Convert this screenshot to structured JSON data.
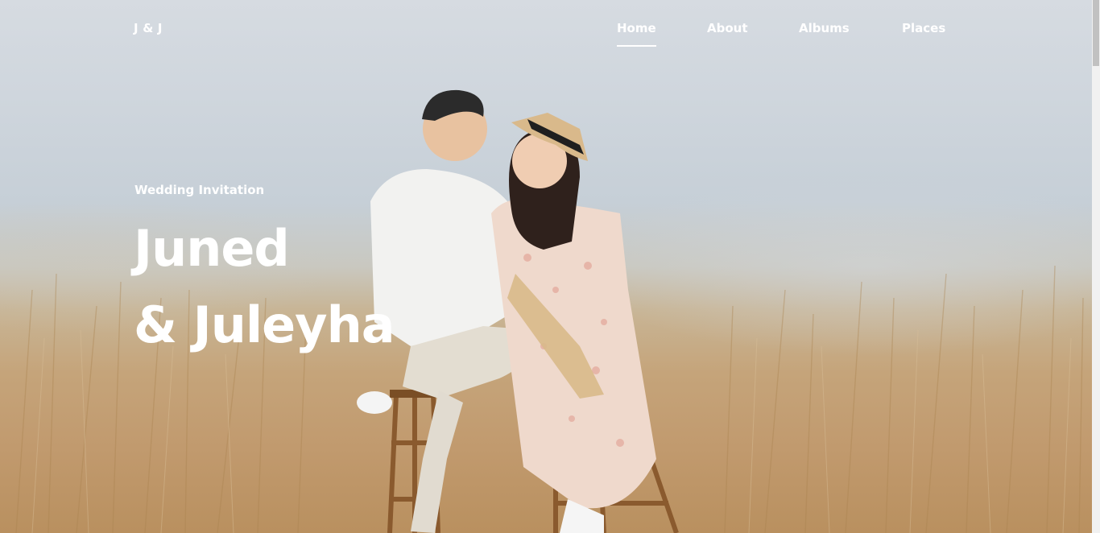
{
  "brand": {
    "label": "J & J"
  },
  "nav": {
    "items": [
      {
        "label": "Home",
        "active": true
      },
      {
        "label": "About",
        "active": false
      },
      {
        "label": "Albums",
        "active": false
      },
      {
        "label": "Places",
        "active": false
      }
    ]
  },
  "hero": {
    "eyebrow": "Wedding Invitation",
    "title_line_1": "Juned",
    "title_line_2": "& Juleyha"
  },
  "colors": {
    "text": "#ffffff",
    "sky": "#cfd6dd",
    "grass": "#c5a47a"
  }
}
